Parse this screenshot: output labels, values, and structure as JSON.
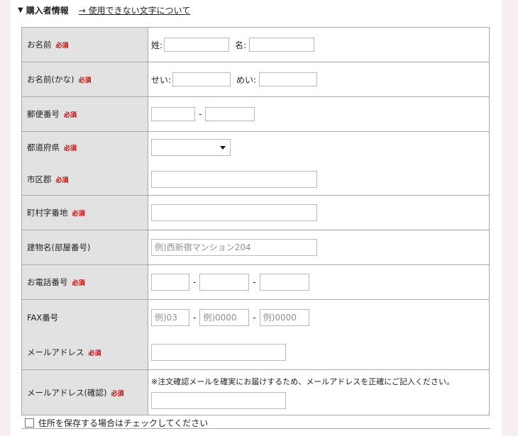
{
  "header": {
    "title": "購入者情報",
    "link": "→ 使用できない文字について"
  },
  "required_label": "必須",
  "rows": {
    "name": {
      "label": "お名前",
      "sei_label": "姓:",
      "mei_label": "名:"
    },
    "kana": {
      "label": "お名前(かな)",
      "sei_label": "せい:",
      "mei_label": "めい:"
    },
    "postal": {
      "label": "郵便番号",
      "sep": "-"
    },
    "pref": {
      "label": "都道府県"
    },
    "city": {
      "label": "市区郡"
    },
    "town": {
      "label": "町村字番地"
    },
    "building": {
      "label": "建物名(部屋番号)",
      "placeholder": "例)西新宿マンション204"
    },
    "phone": {
      "label": "お電話番号",
      "sep": "-"
    },
    "fax": {
      "label": "FAX番号",
      "sep": "-",
      "ph1": "例)03",
      "ph2": "例)0000",
      "ph3": "例)0000"
    },
    "email": {
      "label": "メールアドレス"
    },
    "email_confirm": {
      "label": "メールアドレス(確認)",
      "note": "※注文確認メールを確実にお届けするため、メールアドレスを正確にご記入ください。"
    }
  },
  "save_address": {
    "label": "住所を保存する場合はチェックしてください",
    "checked": false
  }
}
